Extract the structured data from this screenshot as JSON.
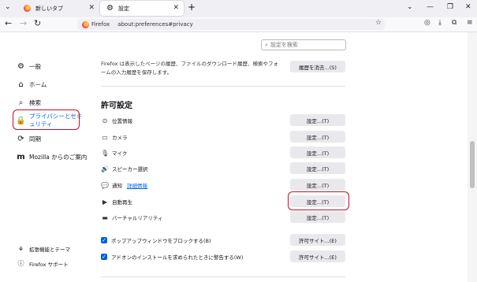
{
  "tabs": [
    {
      "label": "新しいタブ"
    },
    {
      "label": "設定"
    }
  ],
  "nav": {
    "brand": "Firefox",
    "url": "about:preferences#privacy"
  },
  "search": {
    "placeholder": "設定を検索"
  },
  "sidebar": {
    "items": [
      {
        "label": "一般"
      },
      {
        "label": "ホーム"
      },
      {
        "label": "検索"
      },
      {
        "label": "プライバシーとセキュリティ"
      },
      {
        "label": "同期"
      },
      {
        "label": "Mozilla からのご案内"
      }
    ],
    "footer": [
      {
        "label": "拡張機能とテーマ"
      },
      {
        "label": "Firefox サポート"
      }
    ]
  },
  "history": {
    "text": "Firefox は表示したページの履歴、ファイルのダウンロード履歴、検索やフォームの入力履歴を保存します。",
    "clear_button": "履歴を消去...(S)"
  },
  "permissions": {
    "title": "許可設定",
    "rows": [
      {
        "label": "位置情報",
        "button": "設定...(T)"
      },
      {
        "label": "カメラ",
        "button": "設定...(T)"
      },
      {
        "label": "マイク",
        "button": "設定...(T)"
      },
      {
        "label": "スピーカー選択",
        "button": "設定...(T)"
      },
      {
        "label": "通知",
        "link": "詳細情報",
        "button": "設定...(T)"
      },
      {
        "label": "自動再生",
        "button": "設定...(T)"
      },
      {
        "label": "バーチャルリアリティ",
        "button": "設定...(T)"
      }
    ],
    "checks": [
      {
        "label": "ポップアップウィンドウをブロックする(B)",
        "button": "許可サイト...(E)"
      },
      {
        "label": "アドオンのインストールを求められたときに警告する(W)",
        "button": "許可サイト...(E)"
      }
    ]
  }
}
